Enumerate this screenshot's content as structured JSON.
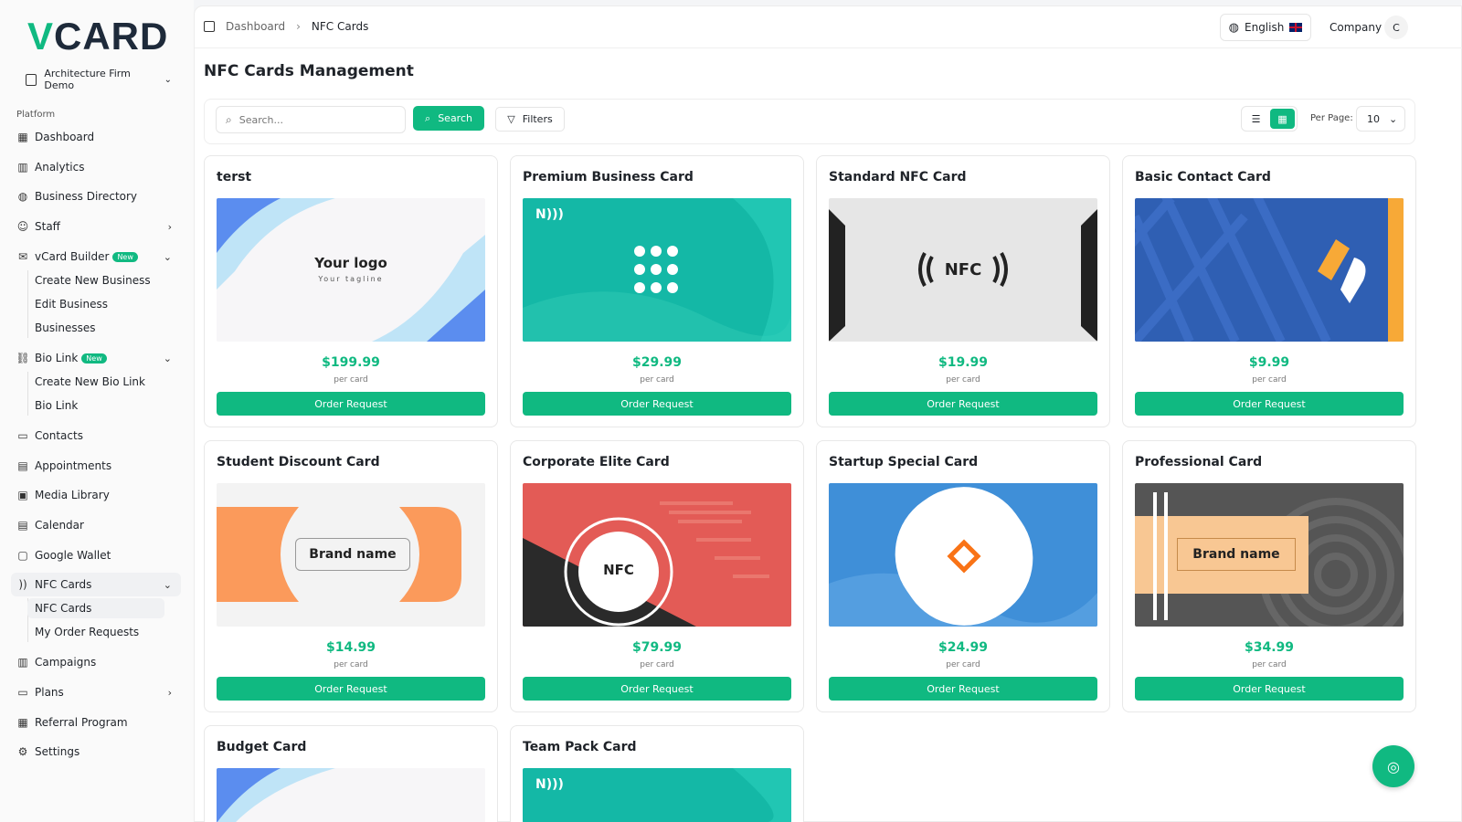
{
  "app": {
    "logo_v": "V",
    "logo_rest": "CARD",
    "workspace": "Architecture Firm Demo"
  },
  "sidebar": {
    "section": "Platform",
    "items": [
      {
        "label": "Dashboard"
      },
      {
        "label": "Analytics"
      },
      {
        "label": "Business Directory"
      },
      {
        "label": "Staff"
      },
      {
        "label": "vCard Builder",
        "badge": "New"
      },
      {
        "label": "Create New Business"
      },
      {
        "label": "Edit Business"
      },
      {
        "label": "Businesses"
      },
      {
        "label": "Bio Link",
        "badge": "New"
      },
      {
        "label": "Create New Bio Link"
      },
      {
        "label": "Bio Link"
      },
      {
        "label": "Contacts"
      },
      {
        "label": "Appointments"
      },
      {
        "label": "Media Library"
      },
      {
        "label": "Calendar"
      },
      {
        "label": "Google Wallet"
      },
      {
        "label": "NFC Cards"
      },
      {
        "label": "NFC Cards"
      },
      {
        "label": "My Order Requests"
      },
      {
        "label": "Campaigns"
      },
      {
        "label": "Plans"
      },
      {
        "label": "Referral Program"
      },
      {
        "label": "Settings"
      }
    ]
  },
  "header": {
    "breadcrumb": [
      "Dashboard",
      "NFC Cards"
    ],
    "language": "English",
    "company": "Company",
    "avatar_initial": "C"
  },
  "page": {
    "title": "NFC Cards Management"
  },
  "toolbar": {
    "search_placeholder": "Search...",
    "search_label": "Search",
    "filters_label": "Filters",
    "per_page_label": "Per Page:",
    "per_page_value": "10"
  },
  "cards": [
    {
      "title": "terst",
      "price": "$199.99",
      "per": "per card",
      "order": "Order Request",
      "logo": "Your logo",
      "tagline": "Your tagline"
    },
    {
      "title": "Premium Business Card",
      "price": "$29.99",
      "per": "per card",
      "order": "Order Request"
    },
    {
      "title": "Standard NFC Card",
      "price": "$19.99",
      "per": "per card",
      "order": "Order Request",
      "nfc": "NFC"
    },
    {
      "title": "Basic Contact Card",
      "price": "$9.99",
      "per": "per card",
      "order": "Order Request"
    },
    {
      "title": "Student Discount Card",
      "price": "$14.99",
      "per": "per card",
      "order": "Order Request",
      "brand": "Brand name"
    },
    {
      "title": "Corporate Elite Card",
      "price": "$79.99",
      "per": "per card",
      "order": "Order Request",
      "nfc": "NFC"
    },
    {
      "title": "Startup Special Card",
      "price": "$24.99",
      "per": "per card",
      "order": "Order Request"
    },
    {
      "title": "Professional Card",
      "price": "$34.99",
      "per": "per card",
      "order": "Order Request",
      "brand": "Brand name"
    },
    {
      "title": "Budget Card"
    },
    {
      "title": "Team Pack Card"
    }
  ],
  "colors": {
    "accent": "#10b981",
    "text": "#1f2329"
  }
}
